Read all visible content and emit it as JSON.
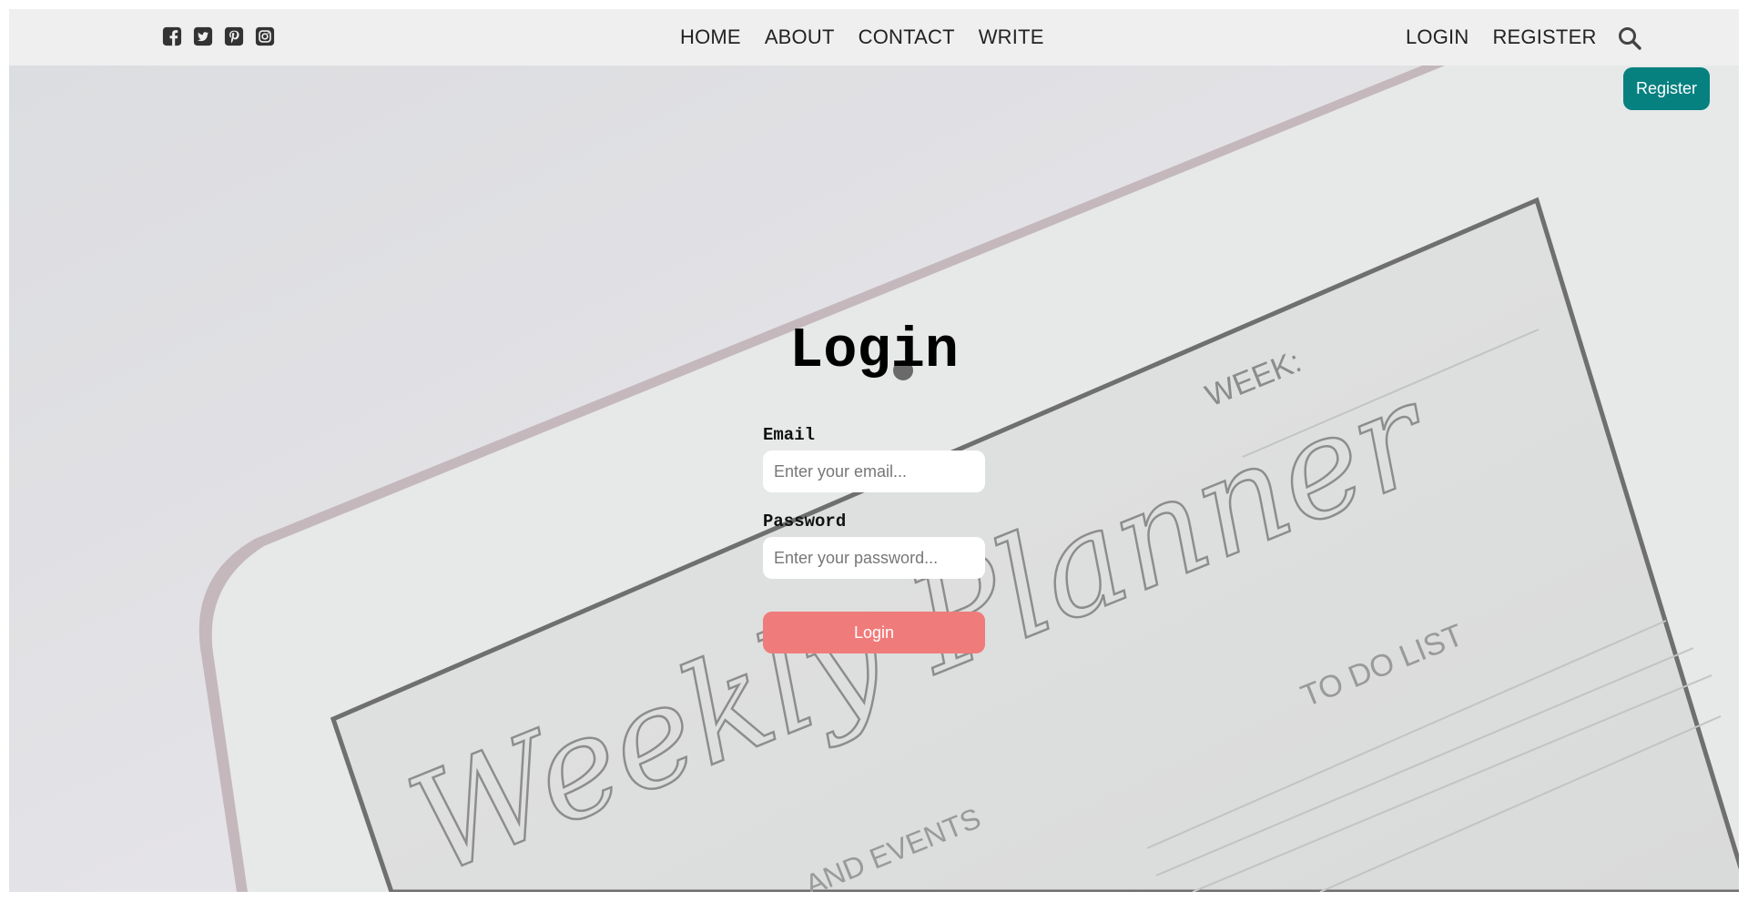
{
  "social": {
    "icons": [
      "facebook-icon",
      "twitter-icon",
      "pinterest-icon",
      "instagram-icon"
    ],
    "icon_color": "#333333"
  },
  "nav": {
    "home": "HOME",
    "about": "ABOUT",
    "contact": "CONTACT",
    "write": "WRITE",
    "login": "LOGIN",
    "register": "REGISTER"
  },
  "search": {
    "icon": "search-icon"
  },
  "register_button": {
    "label": "Register",
    "color": "#078080"
  },
  "login_form": {
    "title": "Login",
    "email_label": "Email",
    "email_placeholder": "Enter your email...",
    "password_label": "Password",
    "password_placeholder": "Enter your password...",
    "submit_label": "Login",
    "submit_color": "#f07b7b"
  },
  "background": {
    "planner_week": "WEEK:",
    "planner_title": "Weekly Planner",
    "planner_todo": "TO DO LIST",
    "planner_events": "AND EVENTS"
  }
}
